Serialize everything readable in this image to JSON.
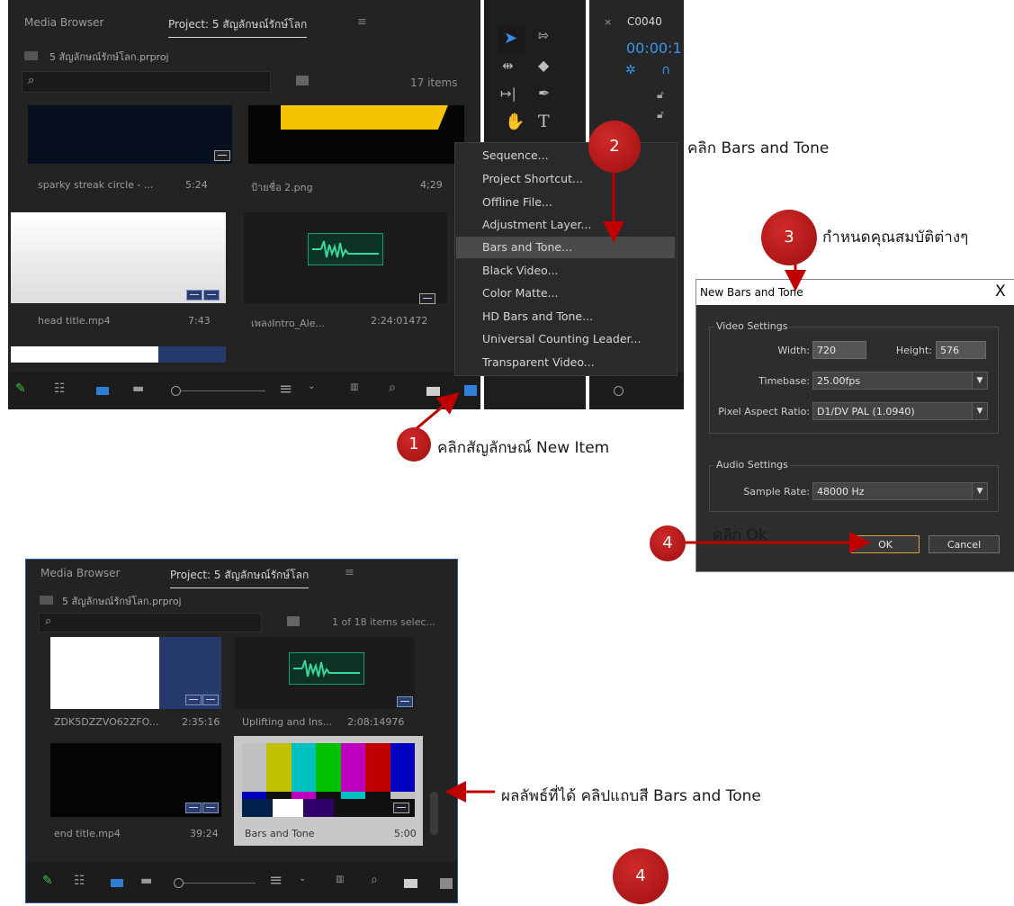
{
  "panel_top": {
    "tabs": [
      "Media Browser",
      "Project: 5 สัญลักษณ์รักษ์โลก"
    ],
    "project_file": "5 สัญลักษณ์รักษ์โลก.prproj",
    "item_count": "17 items",
    "clips": [
      {
        "name": "sparky streak circle - ...",
        "duration": "5:24"
      },
      {
        "name": "ป้ายชื่อ 2.png",
        "duration": "4;29"
      },
      {
        "name": "head title.mp4",
        "duration": "7:43"
      },
      {
        "name": "เพลงIntro_Ale...",
        "duration": "2:24:01472"
      }
    ],
    "new_item_menu": [
      "Sequence...",
      "Project Shortcut...",
      "Offline File...",
      "Adjustment Layer...",
      "Bars and Tone...",
      "Black Video...",
      "Color Matte...",
      "HD Bars and Tone...",
      "Universal Counting Leader...",
      "Transparent Video..."
    ],
    "highlighted_menu_item": "Bars and Tone...",
    "timeline_tab": "C0040",
    "timecode": "00:00:1"
  },
  "dialog": {
    "title": "New Bars and Tone",
    "close": "X",
    "video_group": "Video Settings",
    "width_label": "Width:",
    "width_value": "720",
    "height_label": "Height:",
    "height_value": "576",
    "timebase_label": "Timebase:",
    "timebase_value": "25.00fps",
    "par_label": "Pixel Aspect Ratio:",
    "par_value": "D1/DV PAL (1.0940)",
    "audio_group": "Audio Settings",
    "sample_rate_label": "Sample Rate:",
    "sample_rate_value": "48000 Hz",
    "ok": "OK",
    "cancel": "Cancel"
  },
  "panel_bottom": {
    "tabs": [
      "Media Browser",
      "Project: 5 สัญลักษณ์รักษ์โลก"
    ],
    "project_file": "5 สัญลักษณ์รักษ์โลก.prproj",
    "item_count": "1 of 18 items selec...",
    "clips": [
      {
        "name": "ZDK5DZZVO62ZFO...",
        "duration": "2:35:16"
      },
      {
        "name": "Uplifting and Ins...",
        "duration": "2:08:14976"
      },
      {
        "name": "end title.mp4",
        "duration": "39:24"
      },
      {
        "name": "Bars and Tone",
        "duration": "5:00"
      }
    ]
  },
  "annotations": {
    "step1": {
      "number": "1",
      "text": "คลิกสัญลักษณ์ New Item"
    },
    "step2": {
      "number": "2",
      "text": "คลิก Bars and Tone"
    },
    "step3": {
      "number": "3",
      "text": "กำหนดคุณสมบัติต่างๆ"
    },
    "step4": {
      "number": "4",
      "text": "คลิก Ok"
    },
    "step4b": {
      "number": "4"
    },
    "result": {
      "text": "ผลลัพธ์ที่ได้ คลิปแถบสี Bars and Tone"
    }
  },
  "colors": {
    "accent_red": "#c00000",
    "panel_bg": "#232323",
    "highlight": "#4a4a4a",
    "selection_blue": "#2b57a7"
  }
}
